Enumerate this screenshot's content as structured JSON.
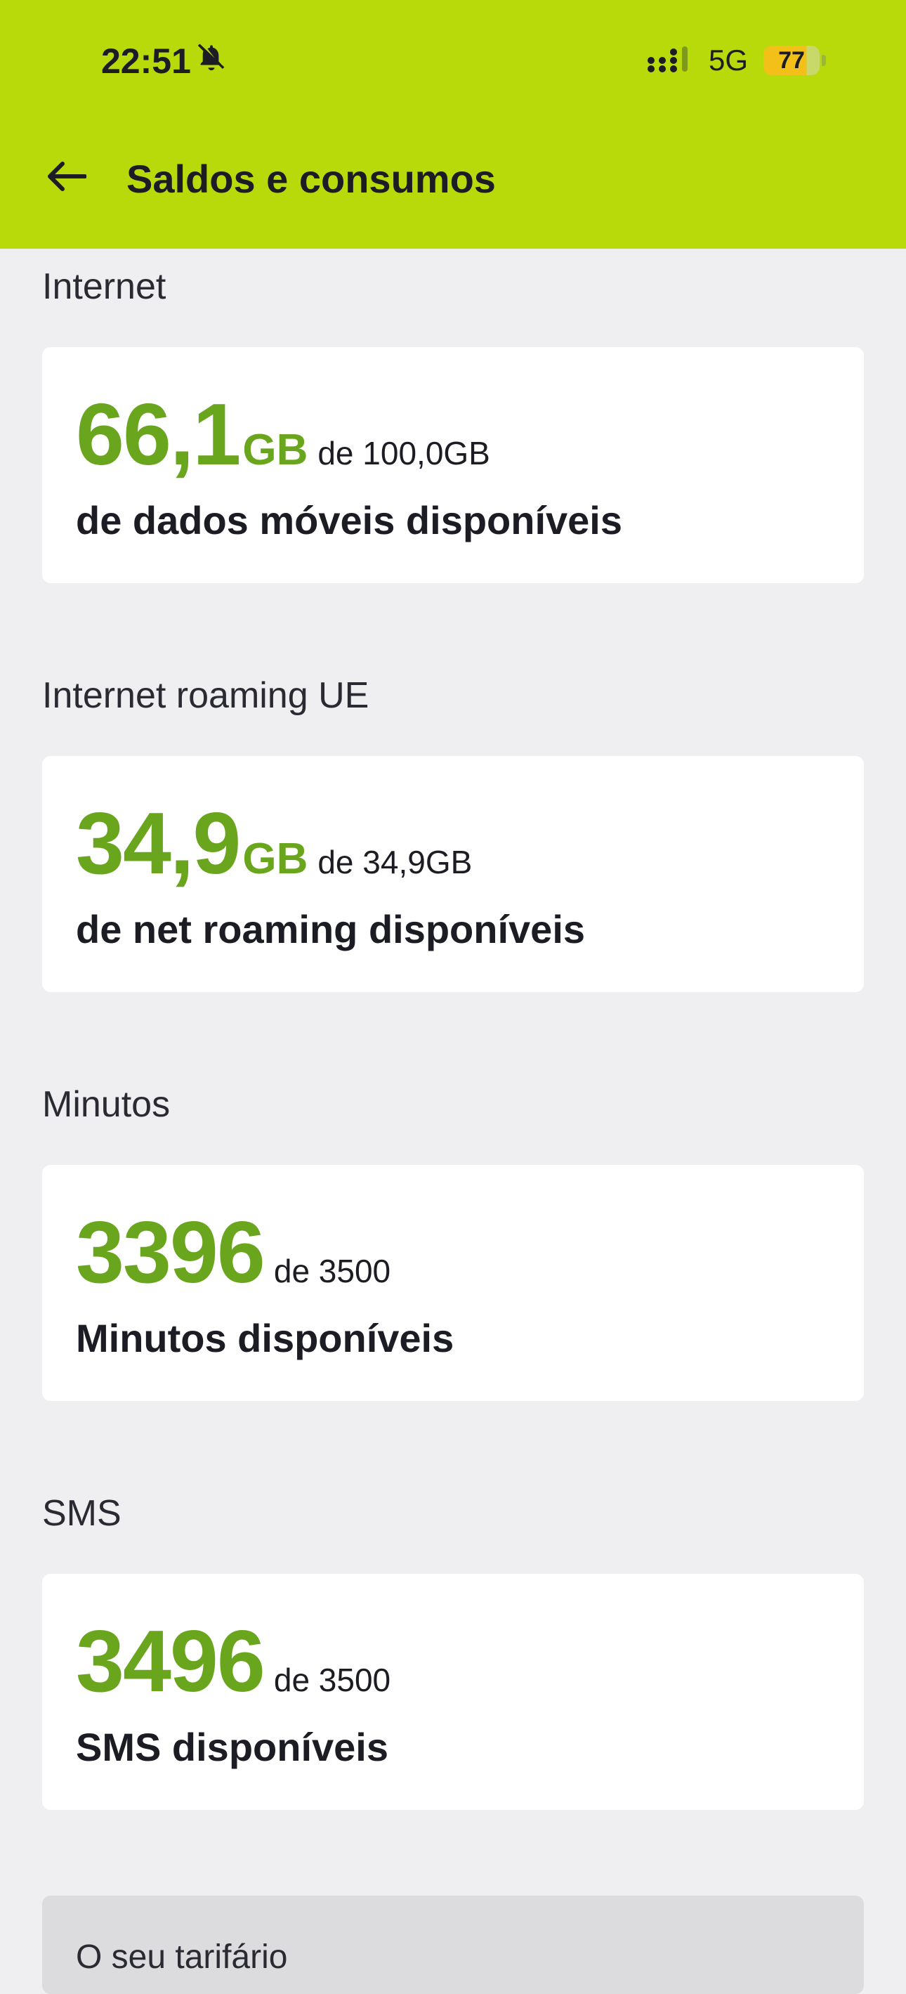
{
  "status_bar": {
    "time": "22:51",
    "network": "5G",
    "battery": "77",
    "battery_level": 0.77
  },
  "header": {
    "title": "Saldos e consumos"
  },
  "sections": [
    {
      "label": "Internet",
      "value": "66,1",
      "unit": "GB",
      "total": "de 100,0GB",
      "description": "de dados móveis disponíveis"
    },
    {
      "label": "Internet roaming UE",
      "value": "34,9",
      "unit": "GB",
      "total": "de 34,9GB",
      "description": "de net roaming disponíveis"
    },
    {
      "label": "Minutos",
      "value": "3396",
      "unit": "",
      "total": "de 3500",
      "description": "Minutos disponíveis"
    },
    {
      "label": "SMS",
      "value": "3496",
      "unit": "",
      "total": "de 3500",
      "description": "SMS disponíveis"
    }
  ],
  "tariff": {
    "label": "O seu tarifário"
  },
  "icons": {
    "back": "arrow-left-icon",
    "mute": "bell-slash-icon",
    "signal": "cellular-signal-icon",
    "battery": "battery-icon"
  },
  "colors": {
    "header_bg": "#b8d90a",
    "accent_green": "#6aa61d",
    "page_bg": "#efeff1"
  }
}
